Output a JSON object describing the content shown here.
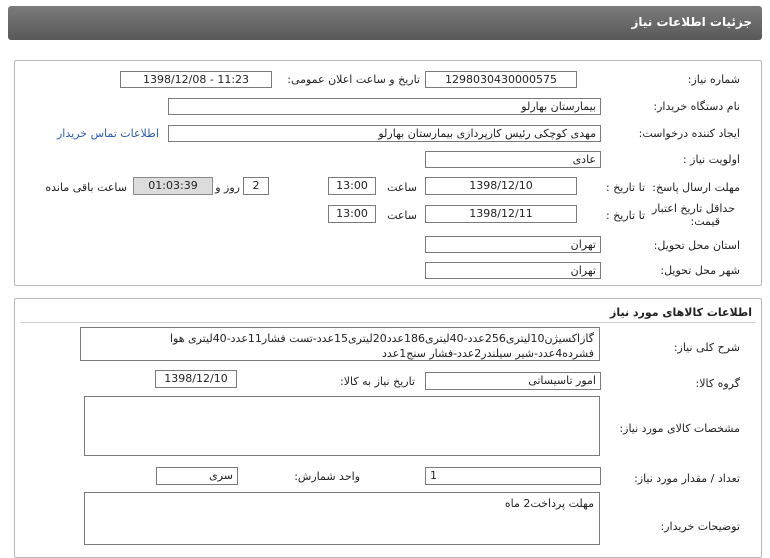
{
  "header": {
    "title": "جزئیات اطلاعات نیاز"
  },
  "need": {
    "number_label": "شماره نیاز:",
    "number_value": "1298030430000575",
    "announce_label": "تاریخ و ساعت اعلان عمومی:",
    "announce_value": "1398/12/08 - 11:23",
    "buyer_label": "نام دستگاه خریدار:",
    "buyer_value": "بیمارستان بهارلو",
    "creator_label": "ایجاد کننده درخواست:",
    "creator_value": "مهدی کوچکی  رئیس کارپردازی بیمارستان بهارلو",
    "contact_link": "اطلاعات تماس خریدار",
    "priority_label": "اولویت نیاز :",
    "priority_value": "عادی",
    "deadline_label": "مهلت ارسال پاسخ:",
    "to_date_label": "تا تاریخ :",
    "deadline_date": "1398/12/10",
    "hour_label": "ساعت",
    "deadline_time": "13:00",
    "days_value": "2",
    "days_label": "روز و",
    "remaining_time": "01:03:39",
    "remaining_label": "ساعت باقی مانده",
    "validity_label_1": "حداقل تاریخ اعتبار",
    "validity_label_2": "قیمت:",
    "validity_date": "1398/12/11",
    "validity_time": "13:00",
    "province_label": "استان محل تحویل:",
    "province_value": "تهران",
    "city_label": "شهر محل تحویل:",
    "city_value": "تهران"
  },
  "goods": {
    "title": "اطلاعات کالاهای مورد نیاز",
    "desc_label": "شرح کلی نیاز:",
    "desc_line1": "گازاکسیژن10لیتری256عدد-40لیتری186عدد20لیتری15عدد-تست فشار11عدد-40لیتری هوا",
    "desc_line2": "فشرده4عدد-شیر سیلندر2عدد-فشار سنج1عدد",
    "group_label": "گروه کالا:",
    "group_value": "امور تاسیساتی",
    "need_date_label": "تاریخ نیاز به کالا:",
    "need_date_value": "1398/12/10",
    "specs_label": "مشخصات کالای مورد نیاز:",
    "specs_value": "",
    "qty_label": "تعداد / مقدار مورد نیاز:",
    "qty_value": "1",
    "unit_label": "واحد شمارش:",
    "unit_value": "سری",
    "buyer_notes_label": "توضیحات خریدار:",
    "buyer_notes_value": "مهلت پرداخت2 ماه"
  }
}
